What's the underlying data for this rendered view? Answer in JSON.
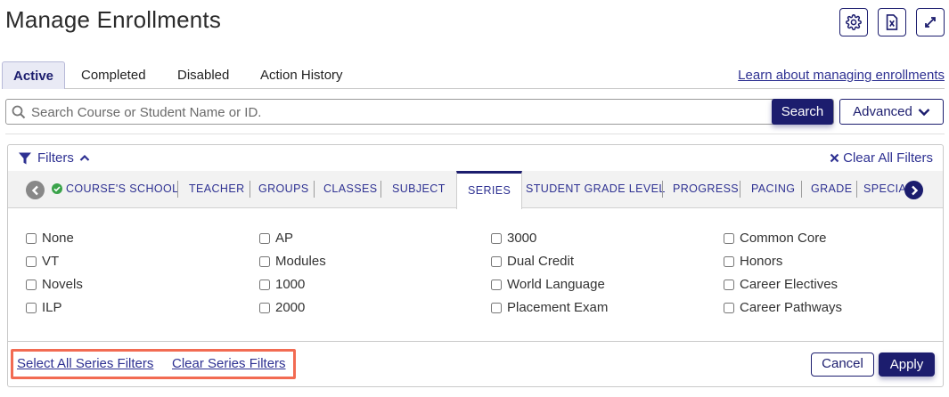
{
  "header": {
    "title": "Manage Enrollments",
    "icons": [
      "gear-icon",
      "excel-export-icon",
      "expand-icon"
    ]
  },
  "tabs": [
    {
      "label": "Active",
      "active": true
    },
    {
      "label": "Completed",
      "active": false
    },
    {
      "label": "Disabled",
      "active": false
    },
    {
      "label": "Action History",
      "active": false
    }
  ],
  "learn_link": "Learn about managing enrollments",
  "search": {
    "placeholder": "Search Course or Student Name or ID.",
    "value": "",
    "button_label": "Search",
    "advanced_label": "Advanced"
  },
  "filters": {
    "toggle_label": "Filters",
    "clear_all_label": "Clear All Filters",
    "categories": [
      {
        "label": "COURSE'S SCHOOL",
        "checked": true
      },
      {
        "label": "TEACHER"
      },
      {
        "label": "GROUPS"
      },
      {
        "label": "CLASSES"
      },
      {
        "label": "SUBJECT"
      },
      {
        "label": "SERIES",
        "active": true
      },
      {
        "label": "STUDENT GRADE LEVEL"
      },
      {
        "label": "PROGRESS"
      },
      {
        "label": "PACING"
      },
      {
        "label": "GRADE"
      },
      {
        "label": "SPECIA"
      }
    ],
    "series_options": [
      [
        "None",
        "VT",
        "Novels",
        "ILP"
      ],
      [
        "AP",
        "Modules",
        "1000",
        "2000"
      ],
      [
        "3000",
        "Dual Credit",
        "World Language",
        "Placement Exam"
      ],
      [
        "Common Core",
        "Honors",
        "Career Electives",
        "Career Pathways"
      ]
    ],
    "select_all_label": "Select All Series Filters",
    "clear_series_label": "Clear Series Filters",
    "cancel_label": "Cancel",
    "apply_label": "Apply"
  },
  "colors": {
    "primary": "#1c1d6e",
    "link": "#2e3192",
    "highlight": "#f26b52",
    "success": "#3aa34a"
  }
}
